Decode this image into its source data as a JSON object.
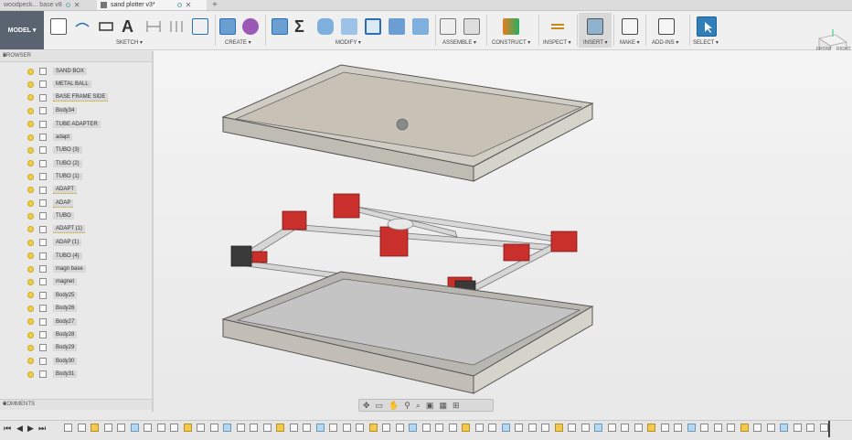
{
  "tabs": [
    {
      "label": "woodpeck... base v8",
      "active": false
    },
    {
      "label": "sand plotter v3*",
      "active": true
    }
  ],
  "new_tab_symbol": "+",
  "toolbar": {
    "workspace": "MODEL",
    "groups": [
      {
        "label": "SKETCH"
      },
      {
        "label": "CREATE"
      },
      {
        "label": "MODIFY"
      },
      {
        "label": "ASSEMBLE"
      },
      {
        "label": "CONSTRUCT"
      },
      {
        "label": "INSPECT"
      },
      {
        "label": "INSERT"
      },
      {
        "label": "MAKE"
      },
      {
        "label": "ADD-INS"
      },
      {
        "label": "SELECT"
      }
    ]
  },
  "browser": {
    "title": "BROWSER",
    "items": [
      {
        "label": "SAND BOX",
        "warn": false
      },
      {
        "label": "METAL BALL",
        "warn": false
      },
      {
        "label": "BASE FRAME SIDE",
        "warn": true
      },
      {
        "label": "Body34",
        "warn": false
      },
      {
        "label": "TUBE ADAPTER",
        "warn": false
      },
      {
        "label": "adapt",
        "warn": false
      },
      {
        "label": "TUBO (3)",
        "warn": false
      },
      {
        "label": "TUBO (2)",
        "warn": false
      },
      {
        "label": "TUBO (1)",
        "warn": false
      },
      {
        "label": "ADAPT",
        "warn": true
      },
      {
        "label": "ADAP",
        "warn": true
      },
      {
        "label": "TUBO",
        "warn": false
      },
      {
        "label": "ADAPT (1)",
        "warn": true
      },
      {
        "label": "ADAP (1)",
        "warn": false
      },
      {
        "label": "TUBO (4)",
        "warn": false
      },
      {
        "label": "magn base",
        "warn": false
      },
      {
        "label": "magnet",
        "warn": false
      },
      {
        "label": "Body25",
        "warn": false
      },
      {
        "label": "Body26",
        "warn": false
      },
      {
        "label": "Body27",
        "warn": false
      },
      {
        "label": "Body28",
        "warn": false
      },
      {
        "label": "Body29",
        "warn": false
      },
      {
        "label": "Body30",
        "warn": false
      },
      {
        "label": "Body31",
        "warn": false
      }
    ]
  },
  "comments": {
    "title": "COMMENTS"
  },
  "viewcube": {
    "front": "FRONT",
    "right": "RIGHT",
    "z": "Z"
  },
  "colors": {
    "accent_red": "#c9302c",
    "toolbar_bg": "#f0f0f0",
    "model_btn": "#5a6470"
  }
}
